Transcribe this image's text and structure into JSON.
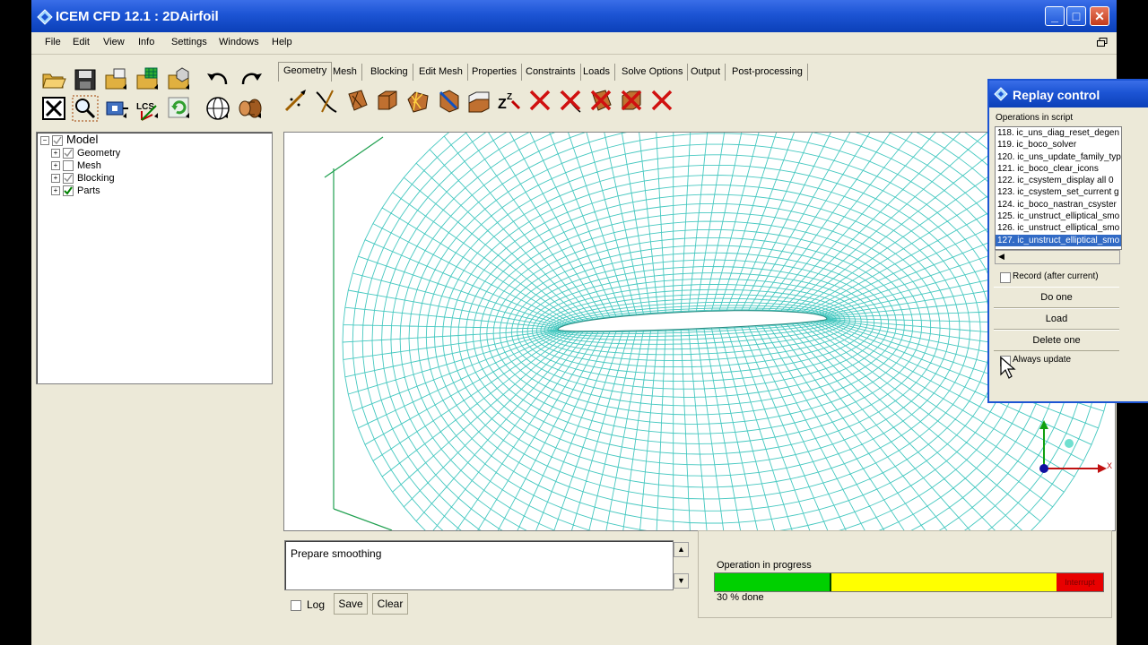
{
  "window": {
    "title": "ICEM CFD 12.1 : 2DAirfoil",
    "min_label": "_",
    "max_label": "□",
    "close_label": "✕"
  },
  "menu": [
    "File",
    "Edit",
    "View",
    "Info",
    "Settings",
    "Windows",
    "Help"
  ],
  "tabs": [
    "Geometry",
    "Mesh",
    "Blocking",
    "Edit Mesh",
    "Properties",
    "Constraints",
    "Loads",
    "Solve Options",
    "Output",
    "Post-processing"
  ],
  "toolbar_icons": {
    "row1": [
      "open-folder-icon",
      "save-icon",
      "open-geometry-icon",
      "open-mesh-icon",
      "open-blocking-icon",
      "undo-icon",
      "redo-icon"
    ],
    "row2": [
      "fit-window-icon",
      "zoom-icon",
      "measure-icon",
      "lcs-icon",
      "refresh-icon",
      "wireframe-icon",
      "solid-icon"
    ]
  },
  "toolbar_text": {
    "lcs": "LCS"
  },
  "geometry_tools": [
    "create-point-icon",
    "create-curve-icon",
    "create-surface-icon",
    "create-body-icon",
    "faceted-geometry-icon",
    "repair-geometry-icon",
    "transform-geometry-icon",
    "restore-dormant-icon",
    "delete-point-icon",
    "delete-curve-icon",
    "delete-surface-icon",
    "delete-body-icon",
    "delete-any-icon"
  ],
  "tree": {
    "root": "Model",
    "children": [
      "Geometry",
      "Mesh",
      "Blocking",
      "Parts"
    ]
  },
  "console": {
    "text": "Prepare smoothing",
    "log_label": "Log",
    "save_label": "Save",
    "clear_label": "Clear"
  },
  "progress": {
    "label": "Operation in progress",
    "fraction": 0.3,
    "done_text": "30 % done",
    "interrupt_label": "Interrupt"
  },
  "axes": {
    "x_label": "X"
  },
  "replay": {
    "title": "Replay control",
    "list_label": "Operations in script",
    "items": [
      "118. ic_uns_diag_reset_degen",
      "119. ic_boco_solver",
      "120. ic_uns_update_family_typ",
      "121. ic_boco_clear_icons",
      "122. ic_csystem_display all 0",
      "123. ic_csystem_set_current g",
      "124. ic_boco_nastran_csyster",
      "125. ic_unstruct_elliptical_smo",
      "126. ic_unstruct_elliptical_smo",
      "127. ic_unstruct_elliptical_smo"
    ],
    "selected_index": 9,
    "record_label": "Record (after current)",
    "do_one_label": "Do one",
    "load_label": "Load",
    "delete_one_label": "Delete one",
    "always_update_label": "Always update"
  },
  "colors": {
    "mesh": "#45c8c0",
    "title_blue": "#1c54d4",
    "progress_done": "#00d000",
    "progress_remaining": "#ffff00",
    "interrupt": "#e80000"
  }
}
